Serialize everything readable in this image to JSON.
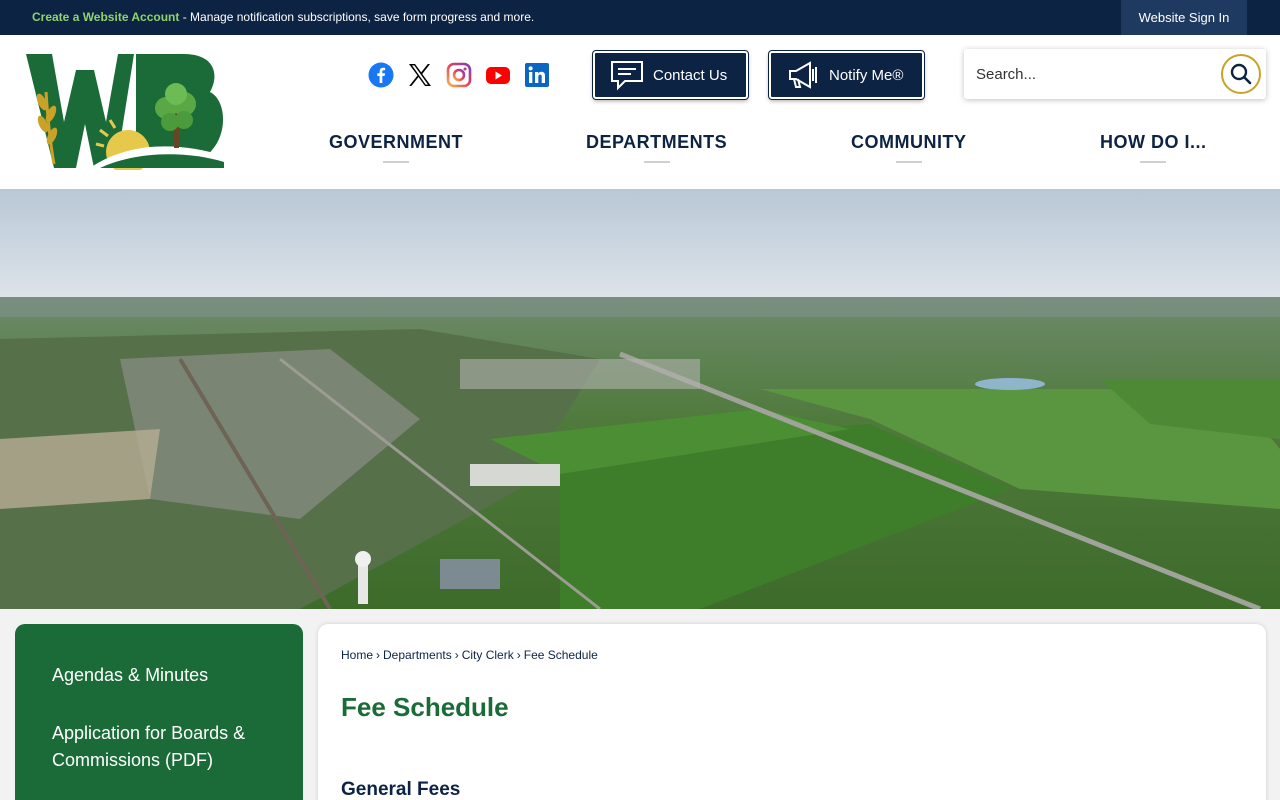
{
  "topbar": {
    "account_link": "Create a Website Account",
    "account_text": " - Manage notification subscriptions, save form progress and more.",
    "sign_in": "Website Sign In"
  },
  "header": {
    "logo_letters": "WB",
    "social": [
      "facebook-icon",
      "x-icon",
      "instagram-icon",
      "youtube-icon",
      "linkedin-icon"
    ],
    "contact_label": "Contact Us",
    "notify_label": "Notify Me®",
    "search_placeholder": "Search..."
  },
  "nav": {
    "items": [
      {
        "label": "GOVERNMENT"
      },
      {
        "label": "DEPARTMENTS"
      },
      {
        "label": "COMMUNITY"
      },
      {
        "label": "HOW DO I..."
      }
    ]
  },
  "sidebar": {
    "items": [
      {
        "label": "Agendas & Minutes"
      },
      {
        "label": "Application for Boards & Commissions (PDF)"
      }
    ]
  },
  "breadcrumb": {
    "items": [
      "Home",
      "Departments",
      "City Clerk",
      "Fee Schedule"
    ],
    "separator": "›"
  },
  "page": {
    "title": "Fee Schedule",
    "section_heading": "General Fees"
  },
  "colors": {
    "navy": "#0c2344",
    "green": "#1a6b38",
    "accent_green": "#8fd36a",
    "gold": "#c9a227"
  }
}
